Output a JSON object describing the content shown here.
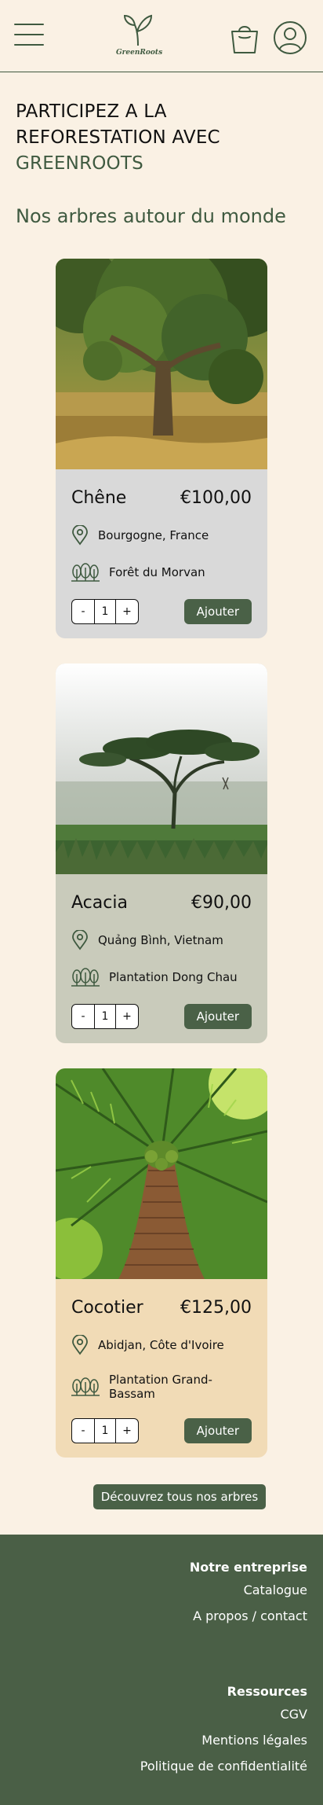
{
  "header": {
    "logo_text": "GreenRoots",
    "icons": {
      "menu": "hamburger-menu-icon",
      "logo": "sprout-icon",
      "cart": "shopping-bag-icon",
      "account": "user-icon"
    }
  },
  "hero": {
    "line1": "PARTICIPEZ A LA",
    "line2": "REFORESTATION AVEC",
    "accent": "GREENROOTS"
  },
  "section_title": "Nos arbres autour du monde",
  "products": [
    {
      "name": "Chêne",
      "price": "€100,00",
      "location": "Bourgogne, France",
      "project": "Forêt du Morvan",
      "quantity": "1",
      "minus": "-",
      "plus": "+",
      "add_label": "Ajouter",
      "card_color": "#d9d9d9"
    },
    {
      "name": "Acacia",
      "price": "€90,00",
      "location": "Quảng Bình, Vietnam",
      "project": "Plantation Dong Chau",
      "quantity": "1",
      "minus": "-",
      "plus": "+",
      "add_label": "Ajouter",
      "card_color": "#c9cbbb"
    },
    {
      "name": "Cocotier",
      "price": "€125,00",
      "location": "Abidjan, Côte d'Ivoire",
      "project": "Plantation Grand-Bassam",
      "quantity": "1",
      "minus": "-",
      "plus": "+",
      "add_label": "Ajouter",
      "card_color": "#f1dbb6"
    }
  ],
  "all_trees_label": "Découvrez tous nos arbres",
  "footer": {
    "company_title": "Notre entreprise",
    "company_links": [
      "Catalogue",
      "A propos / contact"
    ],
    "resources_title": "Ressources",
    "resources_links": [
      "CGV",
      "Mentions légales",
      "Politique de confidentialité"
    ]
  },
  "colors": {
    "background": "#faf1e4",
    "brand_green": "#3f5a40",
    "button_green": "#4a6147",
    "footer_green": "#4a5f46"
  }
}
